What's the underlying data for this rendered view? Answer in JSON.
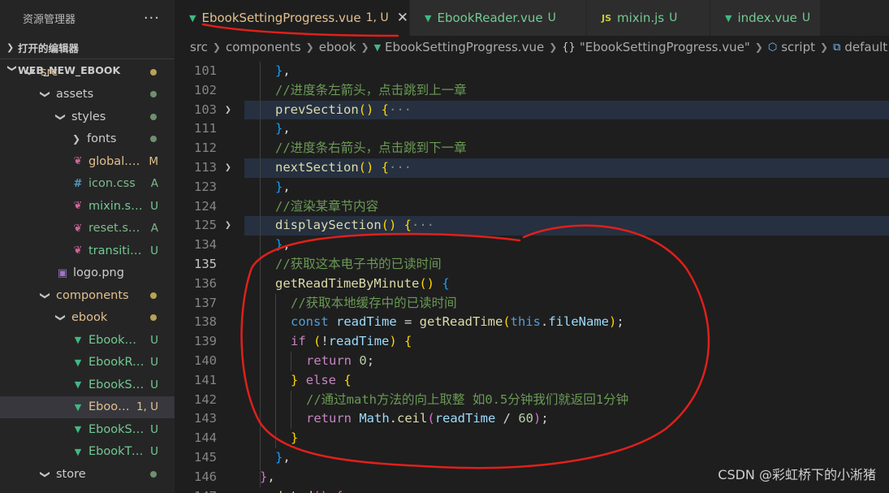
{
  "sidebar": {
    "title": "资源管理器",
    "more": "···",
    "open_editors": "打开的编辑器",
    "project": "WEB_NEW_EBOOK",
    "tree": [
      {
        "name": "src",
        "kind": "folder",
        "open": true,
        "depth": 0,
        "status": "dot",
        "color": "#e2c08d"
      },
      {
        "name": "assets",
        "kind": "folder",
        "open": true,
        "depth": 1,
        "status": "dot",
        "color": "#cccccc",
        "dot": "#6f8f6f"
      },
      {
        "name": "styles",
        "kind": "folder",
        "open": true,
        "depth": 2,
        "status": "dot",
        "color": "#cccccc",
        "dot": "#6f8f6f"
      },
      {
        "name": "fonts",
        "kind": "folder",
        "open": false,
        "depth": 3,
        "status": "dot",
        "color": "#cccccc",
        "dot": "#6f8f6f"
      },
      {
        "name": "global.scss",
        "kind": "scss",
        "depth": 3,
        "status": "M",
        "color": "#e2c08d",
        "badge_color": "#e2c08d"
      },
      {
        "name": "icon.css",
        "kind": "css",
        "depth": 3,
        "status": "A",
        "color": "#81b88b",
        "badge_color": "#81b88b"
      },
      {
        "name": "mixin.scss",
        "kind": "scss",
        "depth": 3,
        "status": "U",
        "color": "#73c991",
        "badge_color": "#73c991"
      },
      {
        "name": "reset.scss",
        "kind": "scss",
        "depth": 3,
        "status": "A",
        "color": "#81b88b",
        "badge_color": "#81b88b"
      },
      {
        "name": "transition.scss",
        "kind": "scss",
        "depth": 3,
        "status": "U",
        "color": "#73c991",
        "badge_color": "#73c991"
      },
      {
        "name": "logo.png",
        "kind": "image",
        "depth": 2,
        "status": "",
        "color": "#cccccc"
      },
      {
        "name": "components",
        "kind": "folder",
        "open": true,
        "depth": 1,
        "status": "dot",
        "color": "#e2c08d",
        "dot": "#b8a255"
      },
      {
        "name": "ebook",
        "kind": "folder",
        "open": true,
        "depth": 2,
        "status": "dot",
        "color": "#e2c08d",
        "dot": "#b8a255"
      },
      {
        "name": "EbookMenu....",
        "kind": "vue",
        "depth": 3,
        "status": "U",
        "color": "#73c991",
        "badge_color": "#73c991"
      },
      {
        "name": "EbookReade...",
        "kind": "vue",
        "depth": 3,
        "status": "U",
        "color": "#73c991",
        "badge_color": "#73c991"
      },
      {
        "name": "EbookSettin...",
        "kind": "vue",
        "depth": 3,
        "status": "U",
        "color": "#73c991",
        "badge_color": "#73c991"
      },
      {
        "name": "EbookSetti...",
        "kind": "vue",
        "depth": 3,
        "status": "1, U",
        "color": "#e2c08d",
        "badge_color": "#e2c08d",
        "active": true
      },
      {
        "name": "EbookSettin...",
        "kind": "vue",
        "depth": 3,
        "status": "U",
        "color": "#73c991",
        "badge_color": "#73c991"
      },
      {
        "name": "EbookTitle.v...",
        "kind": "vue",
        "depth": 3,
        "status": "U",
        "color": "#73c991",
        "badge_color": "#73c991"
      },
      {
        "name": "store",
        "kind": "folder",
        "open": true,
        "depth": 1,
        "status": "dot",
        "color": "#cccccc",
        "dot": "#6f8f6f"
      }
    ]
  },
  "tabs": [
    {
      "label": "EbookSettingProgress.vue",
      "icon": "vue-icon",
      "status": "1, U",
      "active": true,
      "color": "#e2c08d",
      "closable": true
    },
    {
      "label": "EbookReader.vue",
      "icon": "vue-icon",
      "status": "U",
      "active": false,
      "color": "#73c991"
    },
    {
      "label": "mixin.js",
      "icon": "js-icon",
      "status": "U",
      "active": false,
      "color": "#73c991"
    },
    {
      "label": "index.vue",
      "icon": "vue-icon",
      "status": "U",
      "active": false,
      "color": "#73c991"
    }
  ],
  "tab_close_glyph": "✕",
  "breadcrumb": {
    "parts": [
      "src",
      "components",
      "ebook",
      "EbookSettingProgress.vue",
      "\"EbookSettingProgress.vue\"",
      "script",
      "default"
    ]
  },
  "editor": {
    "lines": [
      {
        "n": "101",
        "indent": 1,
        "tokens": [
          [
            "br2",
            "}"
          ],
          [
            "",
            ","
          ]
        ]
      },
      {
        "n": "102",
        "indent": 1,
        "tokens": [
          [
            "cm",
            "//进度条左箭头，点击跳到上一章"
          ]
        ]
      },
      {
        "n": "103",
        "indent": 1,
        "fold": true,
        "tokens": [
          [
            "fn",
            "prevSection"
          ],
          [
            "br3",
            "()"
          ],
          [
            "",
            " "
          ],
          [
            "br3",
            "{"
          ],
          [
            "ell",
            "···"
          ]
        ]
      },
      {
        "n": "111",
        "indent": 1,
        "tokens": [
          [
            "br2",
            "}"
          ],
          [
            "",
            ","
          ]
        ]
      },
      {
        "n": "112",
        "indent": 1,
        "tokens": [
          [
            "cm",
            "//进度条右箭头，点击跳到下一章"
          ]
        ]
      },
      {
        "n": "113",
        "indent": 1,
        "fold": true,
        "tokens": [
          [
            "fn",
            "nextSection"
          ],
          [
            "br3",
            "()"
          ],
          [
            "",
            " "
          ],
          [
            "br3",
            "{"
          ],
          [
            "ell",
            "···"
          ]
        ]
      },
      {
        "n": "123",
        "indent": 1,
        "tokens": [
          [
            "br2",
            "}"
          ],
          [
            "",
            ","
          ]
        ]
      },
      {
        "n": "124",
        "indent": 1,
        "tokens": [
          [
            "cm",
            "//渲染某章节内容"
          ]
        ]
      },
      {
        "n": "125",
        "indent": 1,
        "fold": true,
        "tokens": [
          [
            "fn",
            "displaySection"
          ],
          [
            "br3",
            "()"
          ],
          [
            "",
            " "
          ],
          [
            "br3",
            "{"
          ],
          [
            "ell",
            "···"
          ]
        ]
      },
      {
        "n": "134",
        "indent": 1,
        "tokens": [
          [
            "br2",
            "}"
          ],
          [
            "",
            ","
          ]
        ]
      },
      {
        "n": "135",
        "indent": 1,
        "current": true,
        "tokens": [
          [
            "cm",
            "//获取这本电子书的已读时间"
          ]
        ]
      },
      {
        "n": "136",
        "indent": 1,
        "tokens": [
          [
            "fn",
            "getReadTimeByMinute"
          ],
          [
            "br3",
            "()"
          ],
          [
            "",
            " "
          ],
          [
            "br2",
            "{"
          ]
        ]
      },
      {
        "n": "137",
        "indent": 2,
        "tokens": [
          [
            "cm",
            "//获取本地缓存中的已读时间"
          ]
        ]
      },
      {
        "n": "138",
        "indent": 2,
        "tokens": [
          [
            "kw",
            "const"
          ],
          [
            "",
            " "
          ],
          [
            "var",
            "readTime"
          ],
          [
            "",
            " = "
          ],
          [
            "fn",
            "getReadTime"
          ],
          [
            "br3",
            "("
          ],
          [
            "kw",
            "this"
          ],
          [
            "",
            "."
          ],
          [
            "var",
            "fileName"
          ],
          [
            "br3",
            ")"
          ],
          [
            "",
            ";"
          ]
        ]
      },
      {
        "n": "139",
        "indent": 2,
        "tokens": [
          [
            "ctl",
            "if"
          ],
          [
            "",
            " "
          ],
          [
            "br3",
            "("
          ],
          [
            "",
            "!"
          ],
          [
            "var",
            "readTime"
          ],
          [
            "br3",
            ")"
          ],
          [
            "",
            " "
          ],
          [
            "br3",
            "{"
          ]
        ]
      },
      {
        "n": "140",
        "indent": 3,
        "tokens": [
          [
            "ctl",
            "return"
          ],
          [
            "",
            " "
          ],
          [
            "num",
            "0"
          ],
          [
            "",
            ";"
          ]
        ]
      },
      {
        "n": "141",
        "indent": 2,
        "tokens": [
          [
            "br3",
            "}"
          ],
          [
            "",
            " "
          ],
          [
            "ctl",
            "else"
          ],
          [
            "",
            " "
          ],
          [
            "br3",
            "{"
          ]
        ]
      },
      {
        "n": "142",
        "indent": 3,
        "tokens": [
          [
            "cm",
            "//通过math方法的向上取整 如0.5分钟我们就返回1分钟"
          ]
        ]
      },
      {
        "n": "143",
        "indent": 3,
        "tokens": [
          [
            "ctl",
            "return"
          ],
          [
            "",
            " "
          ],
          [
            "var",
            "Math"
          ],
          [
            "",
            "."
          ],
          [
            "fn",
            "ceil"
          ],
          [
            "br1",
            "("
          ],
          [
            "var",
            "readTime"
          ],
          [
            "",
            " / "
          ],
          [
            "num",
            "60"
          ],
          [
            "br1",
            ")"
          ],
          [
            "",
            ";"
          ]
        ]
      },
      {
        "n": "144",
        "indent": 2,
        "tokens": [
          [
            "br3",
            "}"
          ]
        ]
      },
      {
        "n": "145",
        "indent": 1,
        "tokens": [
          [
            "br2",
            "}"
          ],
          [
            "",
            ","
          ]
        ]
      },
      {
        "n": "146",
        "indent": 0,
        "tokens": [
          [
            "br1",
            "}"
          ],
          [
            "",
            ","
          ]
        ]
      },
      {
        "n": "147",
        "indent": 0,
        "tokens": [
          [
            "fn",
            "updated"
          ],
          [
            "br1",
            "()"
          ],
          [
            "",
            " "
          ],
          [
            "br1",
            "{"
          ]
        ]
      }
    ]
  },
  "watermark": "CSDN @彩虹桥下的小淅猪",
  "annotation_color": "#e0201b"
}
